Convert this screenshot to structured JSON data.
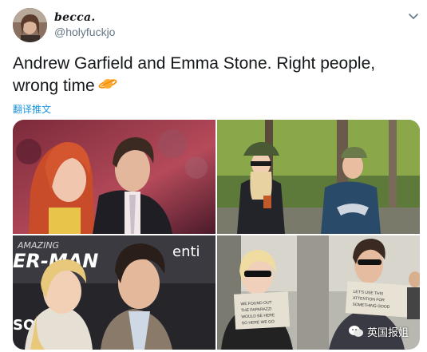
{
  "author": {
    "display_name": "becca.",
    "handle": "@holyfuckjo",
    "avatar_icon": "user-avatar"
  },
  "tweet": {
    "text": "Andrew Garfield and Emma Stone. Right people, wrong time",
    "emoji": "ringed-planet",
    "translate_label": "翻译推文"
  },
  "media": {
    "tiles": [
      {
        "name": "red-carpet-photo"
      },
      {
        "name": "street-hats-photo"
      },
      {
        "name": "premiere-backdrop-photo",
        "backdrop_text_1": "AMAZING",
        "backdrop_text_2": "ER-MAN",
        "backdrop_text_3": "enti",
        "backdrop_text_4": "SO"
      },
      {
        "name": "paparazzi-signs-photo"
      }
    ]
  },
  "watermark": {
    "text": "英国报姐"
  },
  "colors": {
    "link": "#1b95e0",
    "secondary_text": "#657786",
    "primary_text": "#14171a"
  }
}
